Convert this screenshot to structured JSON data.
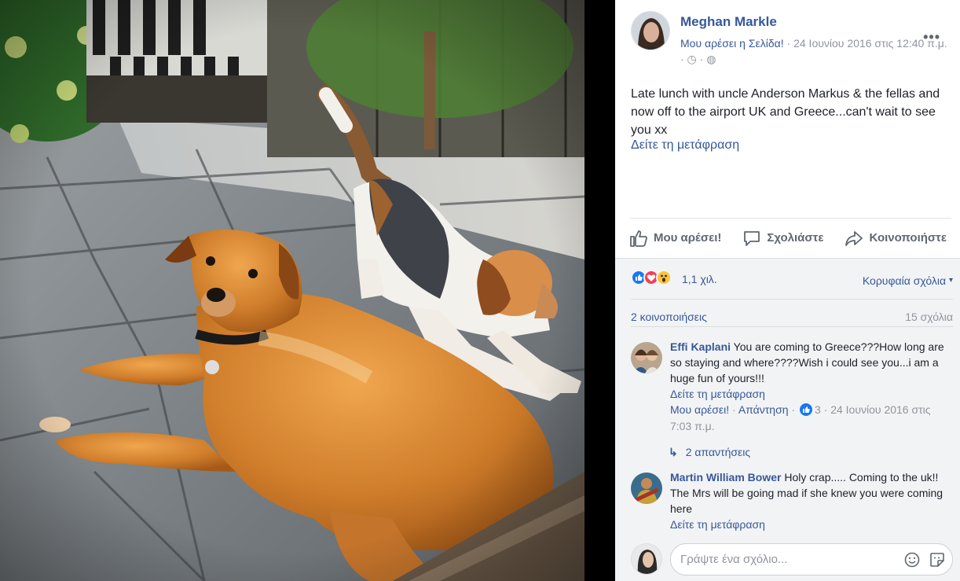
{
  "post": {
    "author": "Meghan Markle",
    "like_page": "Μου αρέσει η Σελίδα!",
    "timestamp": "24 Ιουνίου 2016 στις 12:40",
    "time_suffix": "π.μ. · ◷ · ◍",
    "text": "Late lunch with uncle Anderson Markus & the fellas and now off to the airport UK and Greece...can't wait to see you xx",
    "see_translation": "Δείτε τη μετάφραση",
    "more": "•••"
  },
  "actions": {
    "like": "Μου αρέσει!",
    "comment": "Σχολιάστε",
    "share": "Κοινοποιήστε"
  },
  "feedback": {
    "reaction_count": "1,1 χιλ.",
    "reaction_icons": [
      "like-icon",
      "love-icon",
      "wow-icon"
    ],
    "top_comments": "Κορυφαία σχόλια",
    "shares": "2 κοινοποιήσεις",
    "comments_count": "15 σχόλια"
  },
  "comments": [
    {
      "name": "Effi Kaplani",
      "text": "You are coming to Greece???How long are so staying and where????Wish i could see you...i am a huge fun of yours!!!",
      "translation": "Δείτε τη μετάφραση",
      "like": "Μου αρέσει!",
      "reply": "Απάντηση",
      "likes": "3",
      "date": "24 Ιουνίου 2016 στις 7:03 π.μ.",
      "replies": "2 απαντήσεις"
    },
    {
      "name": "Martin William Bower",
      "text": "Holy crap..... Coming to the uk!! The Mrs will be going mad if she knew you were coming here",
      "translation": "Δείτε τη μετάφραση"
    }
  ],
  "compose": {
    "placeholder": "Γράψτε ένα σχόλιο..."
  },
  "colors": {
    "link": "#365899",
    "muted": "#90949c",
    "like_blue": "#1877f2",
    "love_red": "#f33e58",
    "wow_yellow": "#fcc33c"
  }
}
